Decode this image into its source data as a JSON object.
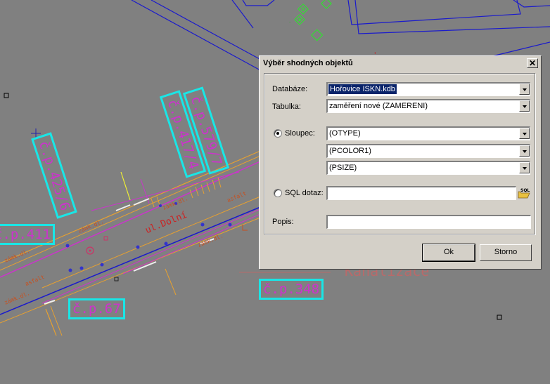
{
  "map": {
    "labels": {
      "cp411": "č.p.411",
      "cp425_6": "č.p.425/6",
      "cp417_4": "č.p.417/4",
      "cp579_7": "č.p.579/7",
      "cp67": "č.p.67",
      "cp348": "č.p.348"
    },
    "street": "ul.Dolní",
    "kanalizace": "Kanalizace",
    "asfalt": "asfalt",
    "zamk_dl": "zámk.dl."
  },
  "dialog": {
    "title": "Výběr shodných objektů",
    "close_glyph": "✕",
    "database_label": "Databáze:",
    "database_value": "Hořovice ISKN.kdb",
    "table_label": "Tabulka:",
    "table_value": "zaměření nové (ZAMERENI)",
    "column_label": "Sloupec:",
    "column_values": [
      "(OTYPE)",
      "(PCOLOR1)",
      "(PSIZE)"
    ],
    "sql_label": "SQL dotaz:",
    "sql_value": "",
    "sql_icon_text": "SQL",
    "description_label": "Popis:",
    "description_value": "",
    "ok_label": "Ok",
    "cancel_label": "Storno"
  }
}
